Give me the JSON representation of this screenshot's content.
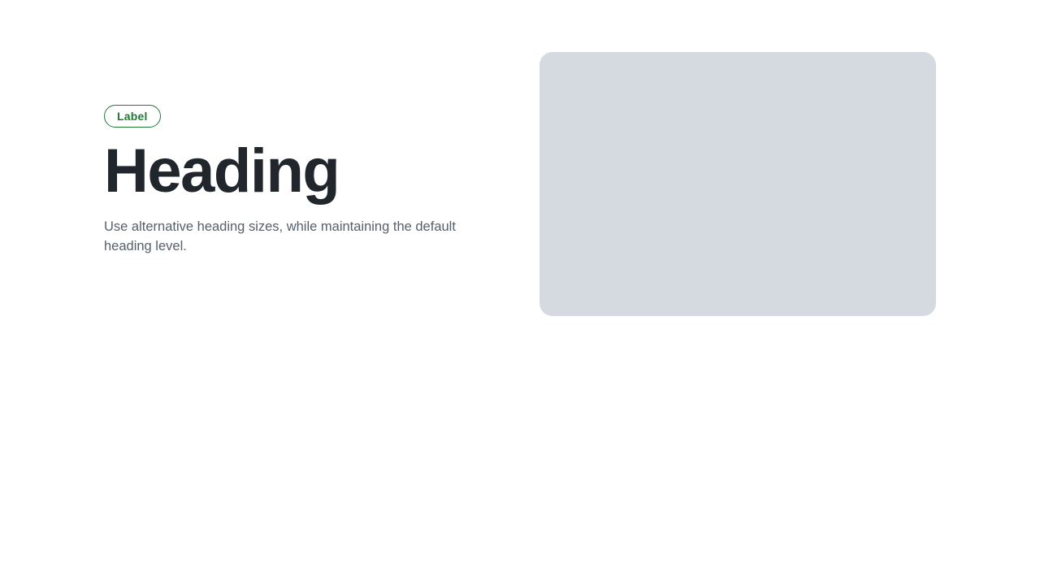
{
  "hero": {
    "label": "Label",
    "heading": "Heading",
    "description": "Use alternative heading sizes, while maintaining the default heading level."
  },
  "colors": {
    "label_accent": "#1f7a34",
    "heading_text": "#21262d",
    "description_text": "#57606a",
    "media_placeholder": "#d5dae1",
    "background": "#ffffff"
  }
}
